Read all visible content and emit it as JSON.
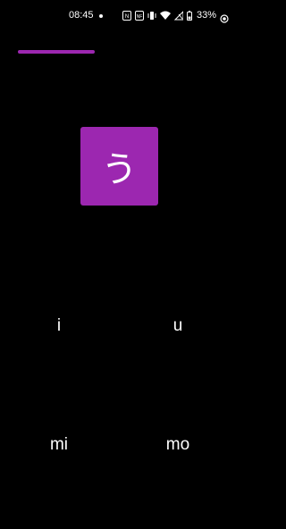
{
  "status_bar": {
    "time": "08:45",
    "battery_percent": "33%",
    "icons": [
      "notification-dot-icon",
      "nfc-icon",
      "nfc-tag-icon",
      "vibrate-icon",
      "wifi-icon",
      "no-signal-icon"
    ]
  },
  "quiz": {
    "progress": 0.38,
    "accent_color": "#9c27b0",
    "kana": "う",
    "options": [
      "i",
      "u",
      "mi",
      "mo"
    ]
  }
}
